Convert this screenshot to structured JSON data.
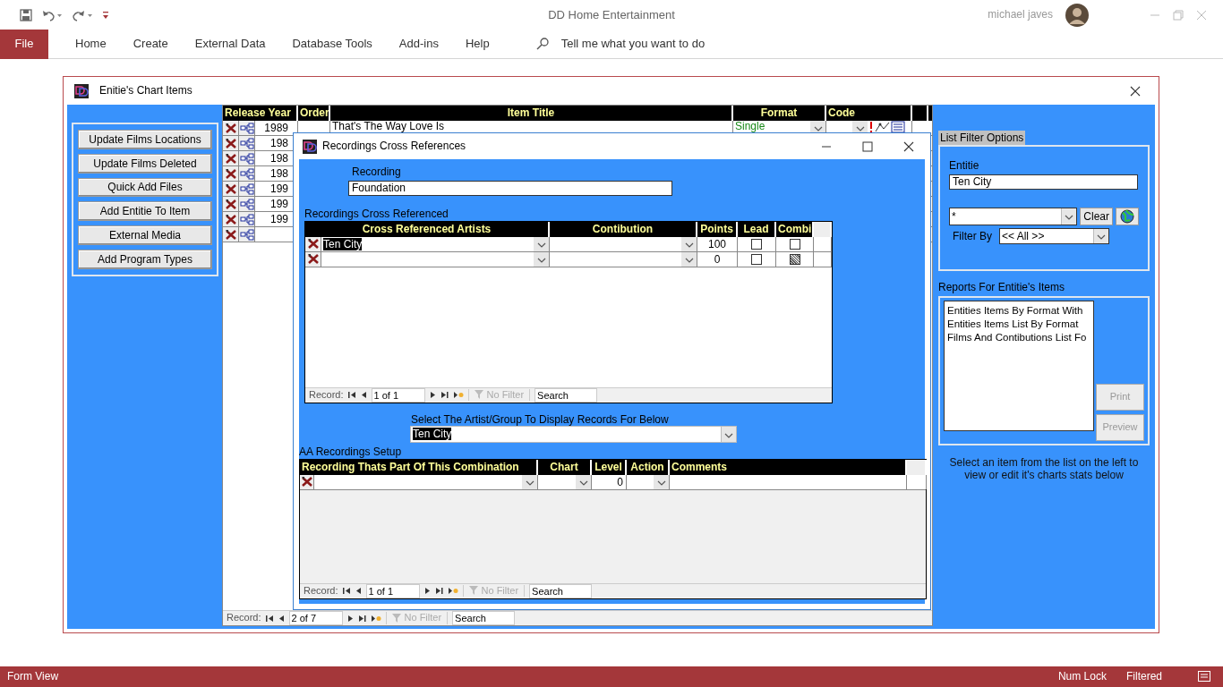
{
  "app": {
    "title": "DD Home Entertainment",
    "user": "michael javes"
  },
  "ribbon": {
    "file_tab": "File",
    "tabs": [
      "Home",
      "Create",
      "External Data",
      "Database Tools",
      "Add-ins",
      "Help"
    ],
    "tell_me": "Tell me what you want to do"
  },
  "chart_items_form": {
    "title": "Enitie's Chart Items",
    "buttons": [
      "Update Films Locations",
      "Update Films Deleted",
      "Quick Add Files",
      "Add Entitie To Item",
      "External Media",
      "Add Program Types"
    ],
    "datasheet": {
      "columns": [
        "Release Year",
        "Order",
        "Item Title",
        "Format",
        "Code"
      ],
      "rows": [
        {
          "release_year": "1989",
          "item_title": "That's The Way Love Is",
          "format": "Single"
        },
        {
          "release_year": "198"
        },
        {
          "release_year": "198"
        },
        {
          "release_year": "198"
        },
        {
          "release_year": "199"
        },
        {
          "release_year": "199"
        },
        {
          "release_year": "199"
        }
      ],
      "navigation": {
        "label": "Record:",
        "position": "2 of 7",
        "filter": "No Filter",
        "search": "Search"
      }
    },
    "filter_panel": {
      "title": "List Filter Options",
      "entitie_label": "Entitie",
      "entitie_value": "Ten City",
      "search_value": "*",
      "clear_button": "Clear",
      "filter_by_label": "Filter By",
      "filter_by_value": "<< All >>"
    },
    "reports": {
      "title": "Reports For Entitie's Items",
      "items": [
        {
          "label": "Entities Items By Format With",
          "selected": false
        },
        {
          "label": "Entities Items List By Format",
          "selected": false
        },
        {
          "label": "Films And Contibutions List Fo",
          "selected": false
        }
      ],
      "print_button": {
        "label": "Print",
        "disabled": true
      },
      "preview_button": {
        "label": "Preview",
        "disabled": true
      }
    },
    "hint": "Select an item from the list on the left to view or edit it's charts stats below"
  },
  "cross_refs_dialog": {
    "title": "Recordings Cross References",
    "recording_label": "Recording",
    "recording_value": "Foundation",
    "grid_label": "Recordings Cross Referenced",
    "grid": {
      "columns": [
        "Cross Referenced Artists",
        "Contibution",
        "Points",
        "Lead",
        "Combi"
      ],
      "rows": [
        {
          "artist": "Ten City",
          "points": "100",
          "lead": false,
          "combi": false
        },
        {
          "points": "0",
          "lead": false,
          "combi_indeterminate": true
        }
      ],
      "navigation": {
        "label": "Record:",
        "position": "1 of 1",
        "filter": "No Filter",
        "search": "Search"
      }
    },
    "artist_select_label": "Select The Artist/Group To Display Records For Below",
    "artist_select_value": "Ten City",
    "setup_label": "AA Recordings Setup",
    "setup_grid": {
      "columns": [
        "Recording Thats Part Of This Combination",
        "Chart",
        "Level",
        "Action",
        "Comments"
      ],
      "rows": [
        {
          "level": "0"
        }
      ],
      "navigation": {
        "label": "Record:",
        "position": "1 of 1",
        "filter": "No Filter",
        "search": "Search"
      }
    }
  },
  "status_bar": {
    "view": "Form View",
    "indicators": [
      "Num Lock",
      "Filtered"
    ]
  }
}
